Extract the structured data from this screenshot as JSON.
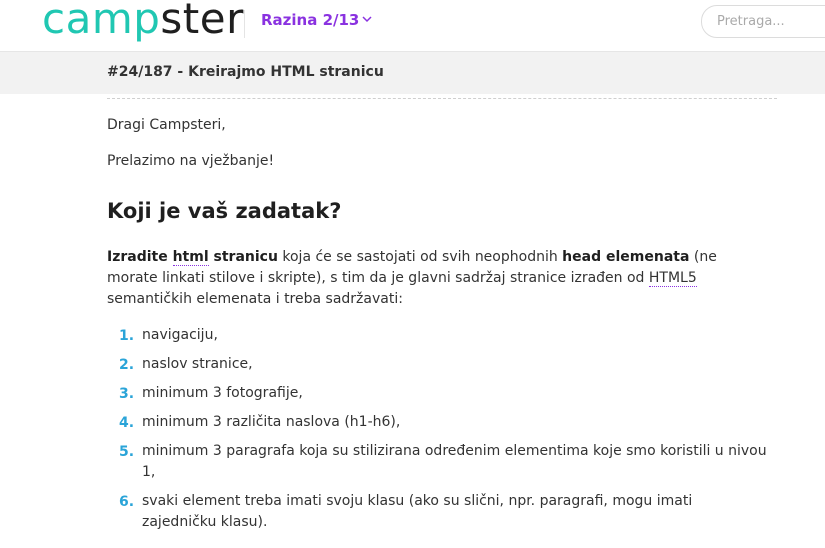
{
  "header": {
    "logo_part1": "camp",
    "logo_part2": "ster",
    "level_label": "Razina 2/13",
    "search_placeholder": "Pretraga..."
  },
  "lesson": {
    "title": "#24/187 - Kreirajmo HTML stranicu"
  },
  "content": {
    "greeting": "Dragi Campsteri,",
    "intro": "Prelazimo na vježbanje!",
    "heading": "Koji je vaš zadatak?",
    "task": {
      "part1": "Izradite ",
      "abbr_html": "html",
      "part2": " stranicu",
      "part3": " koja će se sastojati od svih neophodnih ",
      "part4": "head elemenata",
      "part5": " (ne morate linkati stilove i skripte), s tim da je glavni sadržaj stranice izrađen od ",
      "abbr_html5": "HTML5",
      "part6": " semantičkih elemenata i treba sadržavati:"
    },
    "list": [
      {
        "num": "1.",
        "text": "navigaciju,"
      },
      {
        "num": "2.",
        "text": "naslov stranice,"
      },
      {
        "num": "3.",
        "text": "minimum 3 fotografije,"
      },
      {
        "num": "4.",
        "text": "minimum 3 različita naslova (h1-h6),"
      },
      {
        "num": "5.",
        "text": "minimum 3 paragrafa koja su stilizirana određenim elementima koje smo koristili u nivou 1,"
      },
      {
        "num": "6.",
        "text": "svaki element treba imati svoju klasu (ako su slični, npr. paragrafi, mogu imati zajedničku klasu)."
      }
    ]
  },
  "colors": {
    "brand": "#20c7b2",
    "accent": "#8a32e0",
    "list_number": "#2aa4d8"
  }
}
